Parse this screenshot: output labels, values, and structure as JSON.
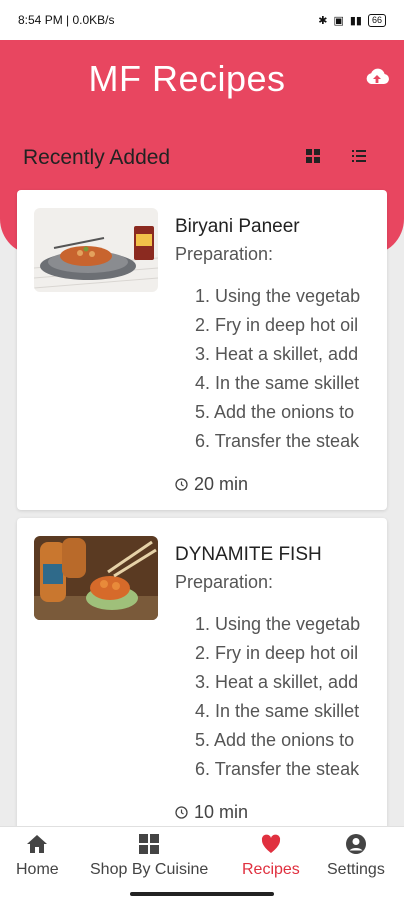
{
  "status_bar": {
    "time": "8:54 PM | 0.0KB/s",
    "icons": [
      "bluetooth-icon",
      "box-icon",
      "signal-icon"
    ],
    "battery": "66"
  },
  "header": {
    "title": "MF Recipes",
    "upload_icon": "cloud-upload-icon",
    "accent": "#e84660"
  },
  "section": {
    "title": "Recently Added",
    "grid_icon": "grid-view-icon",
    "list_icon": "list-view-icon"
  },
  "recipes": [
    {
      "name": "Biryani Paneer",
      "prep_label": "Preparation:",
      "steps": [
        "1. Using the vegetab",
        "2. Fry in deep hot oil",
        "3. Heat a skillet, add",
        "4. In the same skillet",
        "5. Add the onions to",
        "6. Transfer the steak"
      ],
      "time": "20 min"
    },
    {
      "name": "DYNAMITE FISH",
      "prep_label": "Preparation:",
      "steps": [
        "1. Using the vegetab",
        "2. Fry in deep hot oil",
        "3. Heat a skillet, add",
        "4. In the same skillet",
        "5. Add the onions to",
        "6. Transfer the steak"
      ],
      "time": "10 min"
    }
  ],
  "nav": [
    {
      "label": "Home",
      "icon": "home-icon"
    },
    {
      "label": "Shop By Cuisine",
      "icon": "grid-icon"
    },
    {
      "label": "Recipes",
      "icon": "heart-icon",
      "active": true
    },
    {
      "label": "Settings",
      "icon": "person-icon"
    }
  ],
  "colors": {
    "active_nav": "#e0303f"
  }
}
